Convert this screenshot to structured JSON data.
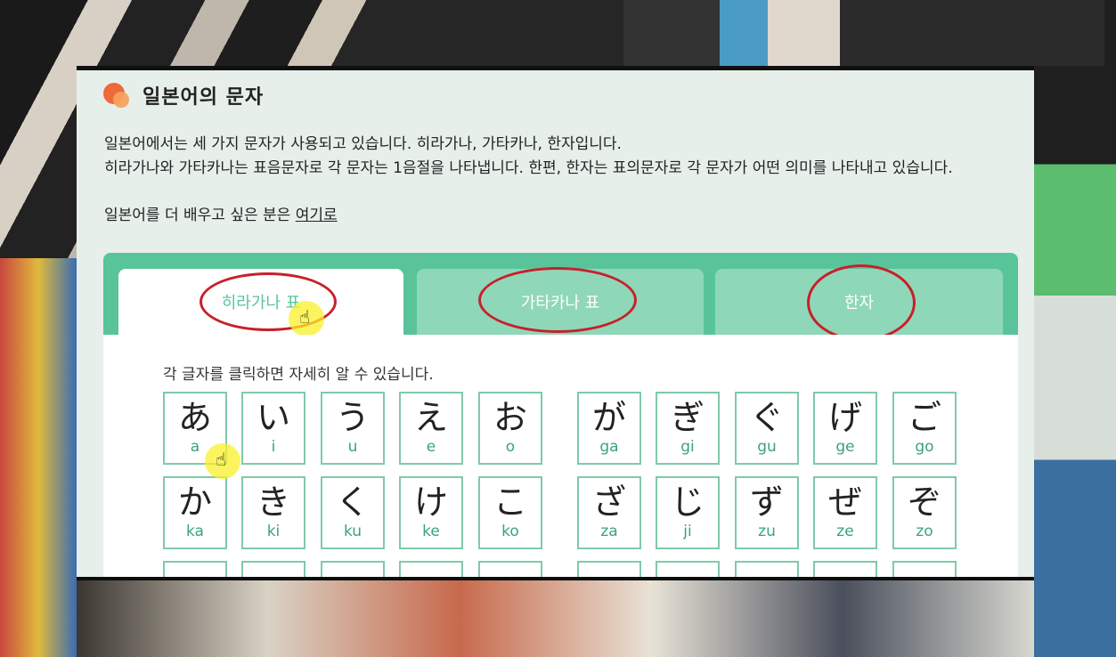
{
  "title": "일본어의 문자",
  "intro": {
    "line1": "일본어에서는 세 가지 문자가 사용되고 있습니다. 히라가나, 가타카나, 한자입니다.",
    "line2": "히라가나와 가타카나는 표음문자로 각 문자는 1음절을 나타냅니다. 한편, 한자는 표의문자로 각 문자가 어떤 의미를 나타내고 있습니다.",
    "more_prefix": "일본어를 더 배우고 싶은 분은 ",
    "more_link": "여기로"
  },
  "tabs": [
    {
      "label": "히라가나 표",
      "active": true
    },
    {
      "label": "가타카나 표",
      "active": false
    },
    {
      "label": "한자",
      "active": false
    }
  ],
  "hint": "각 글자를 클릭하면 자세히 알 수 있습니다.",
  "kana_rows": [
    [
      {
        "kana": "あ",
        "romaji": "a"
      },
      {
        "kana": "い",
        "romaji": "i"
      },
      {
        "kana": "う",
        "romaji": "u"
      },
      {
        "kana": "え",
        "romaji": "e"
      },
      {
        "kana": "お",
        "romaji": "o"
      },
      {
        "kana": "が",
        "romaji": "ga"
      },
      {
        "kana": "ぎ",
        "romaji": "gi"
      },
      {
        "kana": "ぐ",
        "romaji": "gu"
      },
      {
        "kana": "げ",
        "romaji": "ge"
      },
      {
        "kana": "ご",
        "romaji": "go"
      }
    ],
    [
      {
        "kana": "か",
        "romaji": "ka"
      },
      {
        "kana": "き",
        "romaji": "ki"
      },
      {
        "kana": "く",
        "romaji": "ku"
      },
      {
        "kana": "け",
        "romaji": "ke"
      },
      {
        "kana": "こ",
        "romaji": "ko"
      },
      {
        "kana": "ざ",
        "romaji": "za"
      },
      {
        "kana": "じ",
        "romaji": "ji"
      },
      {
        "kana": "ず",
        "romaji": "zu"
      },
      {
        "kana": "ぜ",
        "romaji": "ze"
      },
      {
        "kana": "ぞ",
        "romaji": "zo"
      }
    ]
  ],
  "colors": {
    "accent": "#59c49a",
    "tab_inactive": "#8fd7b9",
    "annotation": "#c8202a",
    "cursor_highlight": "#faf028"
  },
  "icons": {
    "logo": "orange-circles-logo",
    "cursor": "hand-pointer-icon"
  }
}
